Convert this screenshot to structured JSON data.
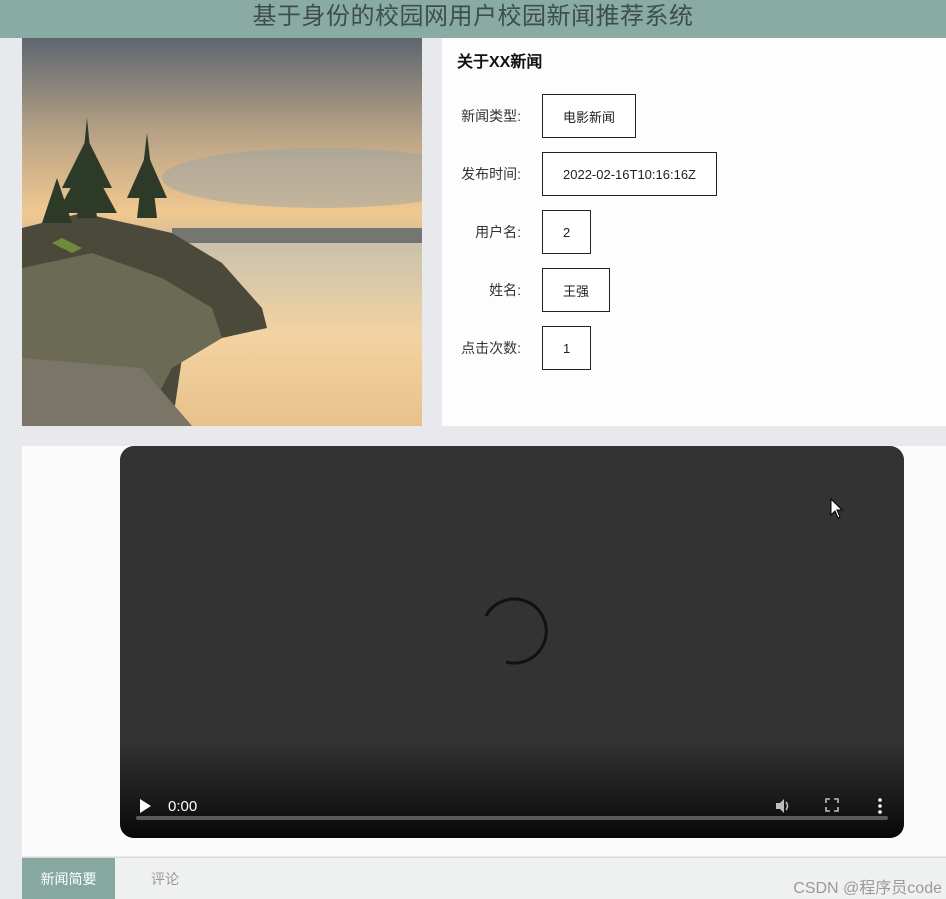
{
  "header": {
    "title": "基于身份的校园网用户校园新闻推荐系统"
  },
  "info": {
    "title": "关于XX新闻",
    "fields": [
      {
        "label": "新闻类型:",
        "value": "电影新闻"
      },
      {
        "label": "发布时间:",
        "value": "2022-02-16T10:16:16Z"
      },
      {
        "label": "用户名:",
        "value": "2"
      },
      {
        "label": "姓名:",
        "value": "王强"
      },
      {
        "label": "点击次数:",
        "value": "1"
      }
    ]
  },
  "video": {
    "time": "0:00",
    "progress": 0
  },
  "tabs": [
    {
      "label": "新闻简要",
      "active": true
    },
    {
      "label": "评论",
      "active": false
    }
  ],
  "watermark": "CSDN @程序员code",
  "colors": {
    "header": "#8aaaa4",
    "active_tab": "#86a8a0",
    "video_bg": "#333333"
  },
  "icons": [
    "play-icon",
    "volume-icon",
    "fullscreen-icon",
    "more-vert-icon",
    "loading-spinner-icon",
    "mouse-cursor-icon"
  ]
}
